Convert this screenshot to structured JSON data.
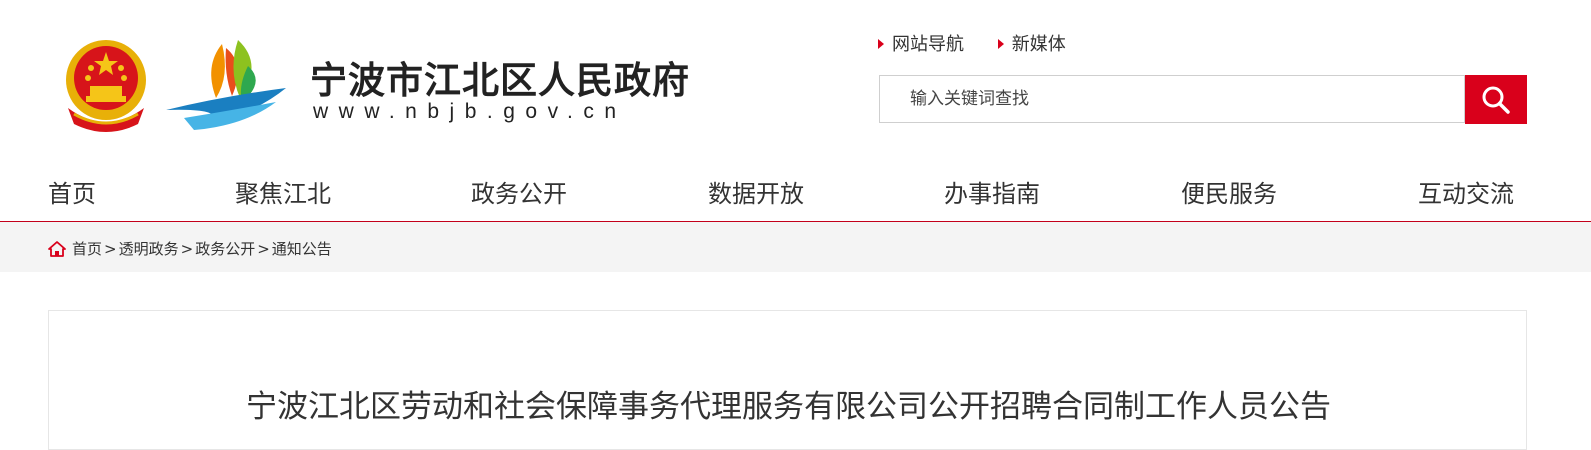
{
  "header": {
    "site_title": "宁波市江北区人民政府",
    "site_url": "www.nbjb.gov.cn",
    "quick_links": [
      {
        "label": "网站导航"
      },
      {
        "label": "新媒体"
      }
    ],
    "search": {
      "placeholder": "输入关键词查找"
    }
  },
  "nav": {
    "items": [
      {
        "label": "首页"
      },
      {
        "label": "聚焦江北"
      },
      {
        "label": "政务公开"
      },
      {
        "label": "数据开放"
      },
      {
        "label": "办事指南"
      },
      {
        "label": "便民服务"
      },
      {
        "label": "互动交流"
      }
    ]
  },
  "breadcrumb": {
    "items": [
      {
        "label": "首页"
      },
      {
        "label": "透明政务"
      },
      {
        "label": "政务公开"
      },
      {
        "label": "通知公告"
      }
    ],
    "separator": ">"
  },
  "article": {
    "title": "宁波江北区劳动和社会保障事务代理服务有限公司公开招聘合同制工作人员公告"
  },
  "colors": {
    "accent": "#d9001b",
    "nav_border": "#c3001a",
    "breadcrumb_bg": "#f4f4f4"
  },
  "icons": [
    "national-emblem-icon",
    "jiangbei-logo-icon",
    "search-icon",
    "home-icon",
    "triangle-bullet-icon"
  ]
}
